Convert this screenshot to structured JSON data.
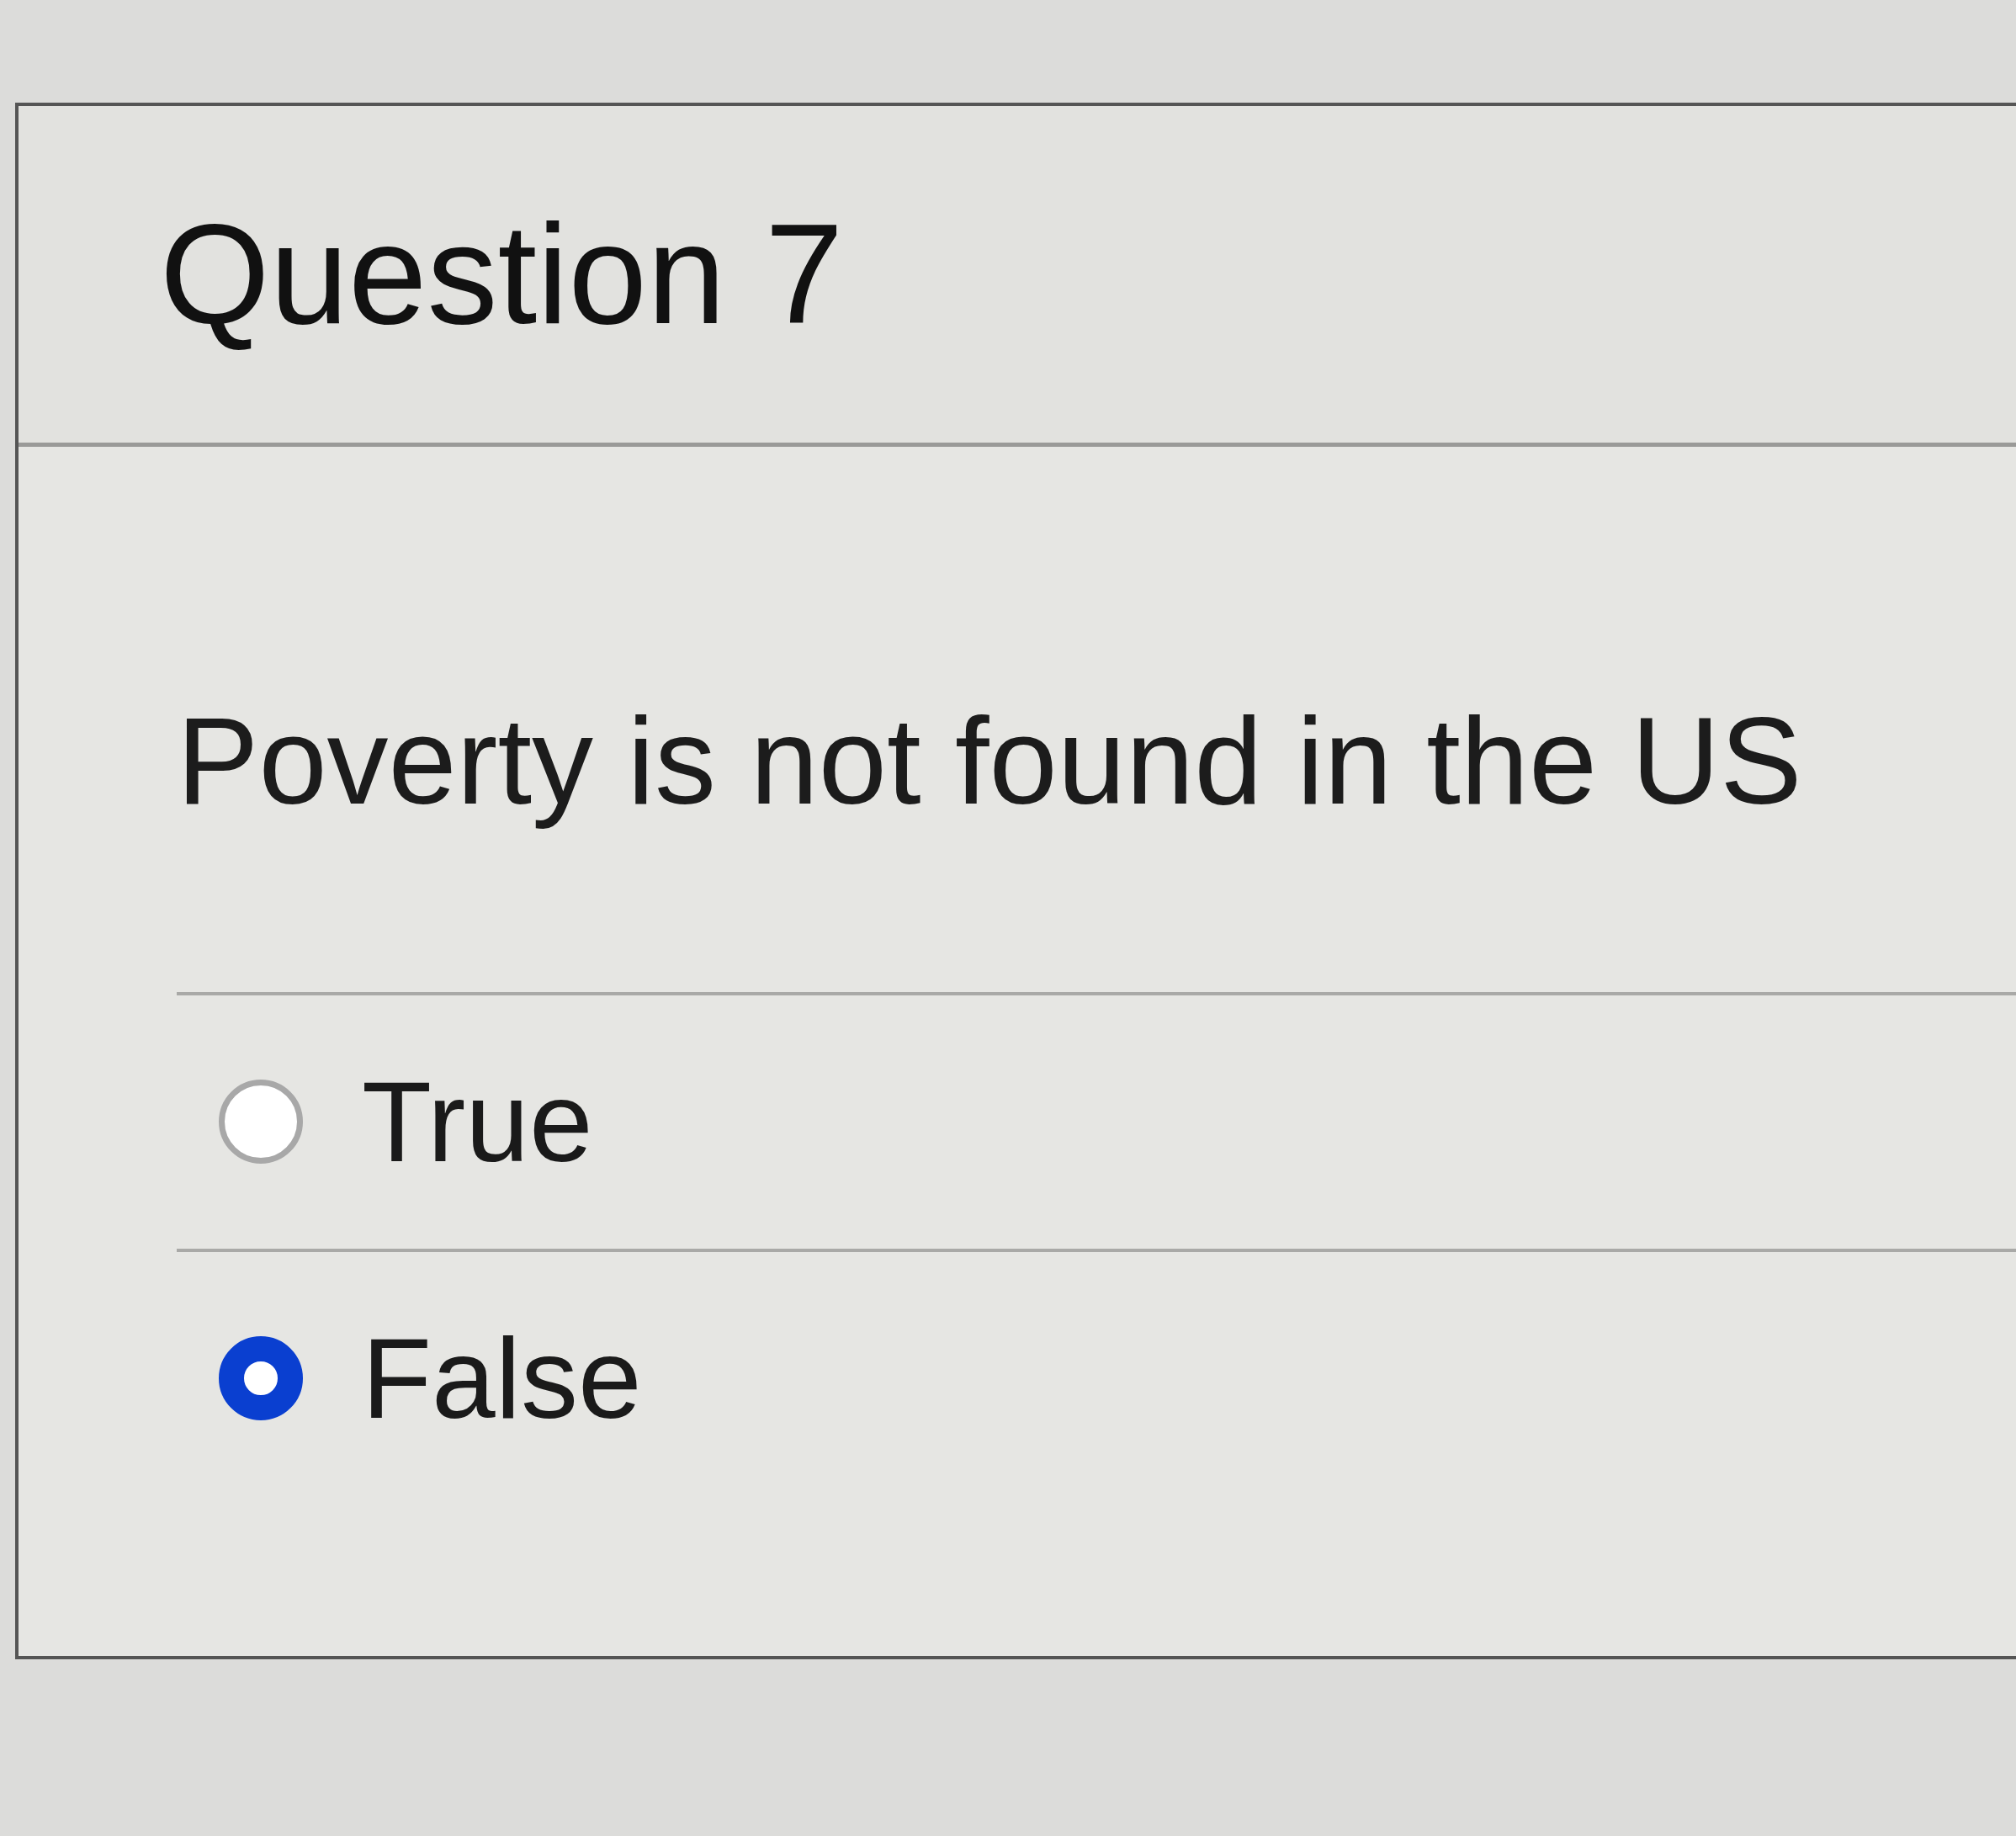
{
  "question": {
    "title": "Question 7",
    "text": "Poverty is not found in the US"
  },
  "options": [
    {
      "label": "True",
      "selected": false
    },
    {
      "label": "False",
      "selected": true
    }
  ]
}
